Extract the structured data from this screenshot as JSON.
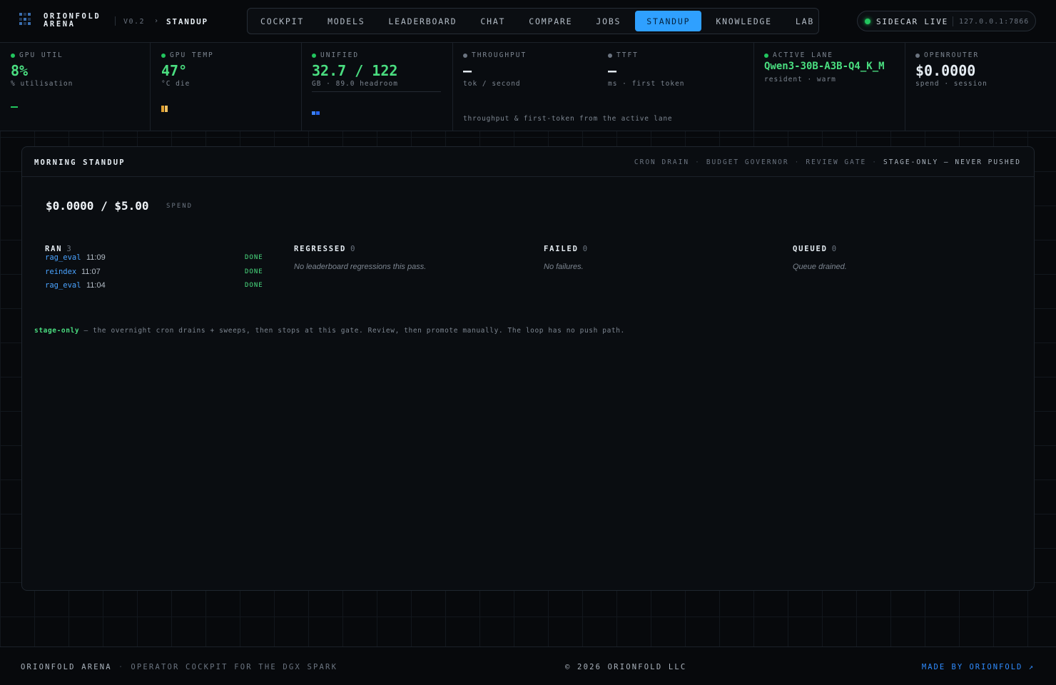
{
  "header": {
    "brand_line1": "ORIONFOLD",
    "brand_line2": "ARENA",
    "version": "V0.2",
    "crumb_separator": "›",
    "breadcrumb": "STANDUP",
    "nav": [
      {
        "label": "COCKPIT",
        "active": false
      },
      {
        "label": "MODELS",
        "active": false
      },
      {
        "label": "LEADERBOARD",
        "active": false
      },
      {
        "label": "CHAT",
        "active": false
      },
      {
        "label": "COMPARE",
        "active": false
      },
      {
        "label": "JOBS",
        "active": false
      },
      {
        "label": "STANDUP",
        "active": true
      },
      {
        "label": "KNOWLEDGE",
        "active": false
      },
      {
        "label": "LAB",
        "active": false
      }
    ],
    "sidecar": {
      "status": "SIDECAR LIVE",
      "address": "127.0.0.1:7866"
    }
  },
  "stats": {
    "gpu_util": {
      "label": "GPU UTIL",
      "value": "8%",
      "sub": "% utilisation"
    },
    "gpu_temp": {
      "label": "GPU TEMP",
      "value": "47°",
      "sub": "°C die"
    },
    "unified": {
      "label": "UNIFIED",
      "value": "32.7 / 122",
      "sub": "GB · 89.0 headroom"
    },
    "throughput": {
      "label": "THROUGHPUT",
      "value": "—",
      "sub": "tok / second"
    },
    "ttft": {
      "label": "TTFT",
      "value": "—",
      "sub": "ms · first token"
    },
    "throughput_note": "throughput & first-token from the active lane",
    "active_lane": {
      "label": "ACTIVE LANE",
      "value": "Qwen3-30B-A3B-Q4_K_M",
      "sub": "resident · warm"
    },
    "openrouter": {
      "label": "OPENROUTER",
      "value": "$0.0000",
      "sub": "spend · session"
    }
  },
  "panel": {
    "title": "MORNING STANDUP",
    "tags": [
      "CRON DRAIN",
      "BUDGET GOVERNOR",
      "REVIEW GATE"
    ],
    "tag_highlight": "STAGE-ONLY — NEVER PUSHED",
    "tag_separator": "·",
    "spend": "$0.0000 / $5.00",
    "spend_label": "SPEND",
    "columns": {
      "ran": {
        "title": "RAN",
        "count": "3",
        "rows": [
          {
            "name": "rag_eval",
            "time": "11:09",
            "status": "DONE"
          },
          {
            "name": "reindex",
            "time": "11:07",
            "status": "DONE"
          },
          {
            "name": "rag_eval",
            "time": "11:04",
            "status": "DONE"
          }
        ]
      },
      "regressed": {
        "title": "REGRESSED",
        "count": "0",
        "empty": "No leaderboard regressions this pass."
      },
      "failed": {
        "title": "FAILED",
        "count": "0",
        "empty": "No failures."
      },
      "queued": {
        "title": "QUEUED",
        "count": "0",
        "empty": "Queue drained."
      }
    },
    "footnote_tag": "stage-only",
    "footnote_text": " — the overnight cron drains + sweeps, then stops at this gate. Review, then promote manually. The loop has no push path."
  },
  "footer": {
    "brand": "ORIONFOLD ARENA",
    "separator": "·",
    "tagline": "OPERATOR COCKPIT FOR THE DGX SPARK",
    "copyright": "© 2026 ORIONFOLD LLC",
    "made_by": "MADE BY ORIONFOLD ↗"
  },
  "colors": {
    "accent": "#2fa0ff",
    "ok": "#4ade80",
    "link": "#4aa3ff"
  }
}
